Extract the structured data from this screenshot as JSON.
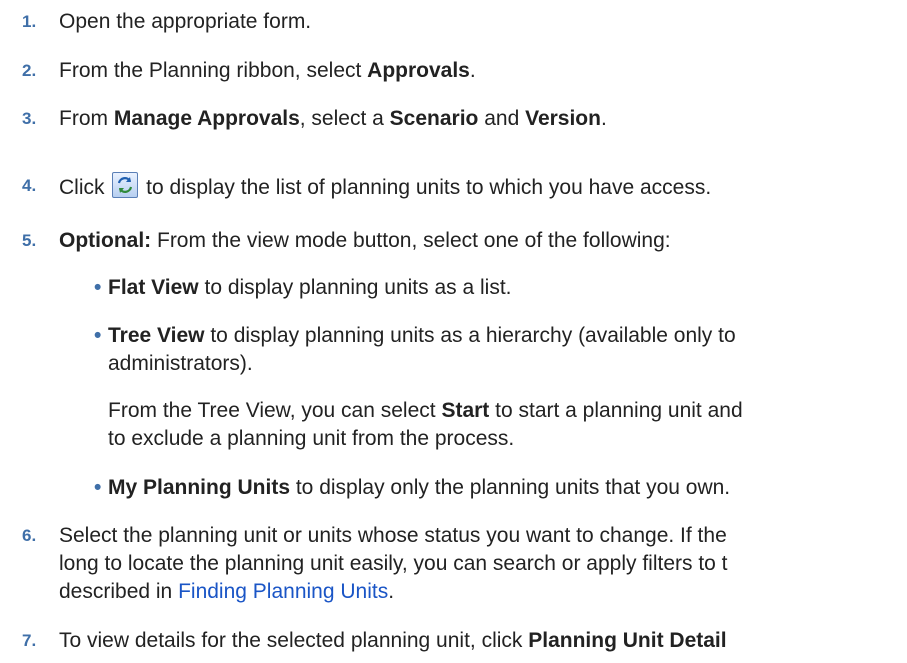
{
  "steps": [
    {
      "num": "1.",
      "text": "Open the appropriate form."
    },
    {
      "num": "2.",
      "pre": "From the Planning ribbon, select ",
      "b1": "Approvals",
      "post": "."
    },
    {
      "num": "3.",
      "pre": "From ",
      "b1": "Manage Approvals",
      "mid": ", select a ",
      "b2": "Scenario",
      "mid2": " and ",
      "b3": "Version",
      "post": "."
    },
    {
      "num": "4.",
      "pre": "Click ",
      "post": " to display the list of planning units to which you have access.",
      "icon": "refresh-icon"
    },
    {
      "num": "5.",
      "b1": "Optional:",
      "post": " From the view mode button, select one of the following:"
    },
    {
      "num": "6.",
      "line1": "Select the planning unit or units whose status you want to change. If the",
      "line2": "long to locate the planning unit easily, you can search or apply filters to t",
      "line3_pre": "described in ",
      "link": "Finding Planning Units",
      "line3_post": "."
    },
    {
      "num": "7.",
      "pre": "To view details for the selected planning unit, click ",
      "b1": "Planning Unit Detail"
    }
  ],
  "bullets": [
    {
      "b": "Flat View",
      "text": " to display planning units as a list."
    },
    {
      "b": "Tree View",
      "text": " to display planning units as a hierarchy (available only to",
      "line2": "administrators).",
      "para_pre": "From the Tree View, you can select ",
      "para_b": "Start",
      "para_post": " to start a planning unit and",
      "para_line2": "to exclude a planning unit from the process."
    },
    {
      "b": "My Planning Units",
      "text": " to display only the planning units that you own."
    }
  ],
  "bullet_char": "•",
  "colors": {
    "number": "#3f6fa8",
    "link": "#1a55c6",
    "text": "#222222"
  }
}
